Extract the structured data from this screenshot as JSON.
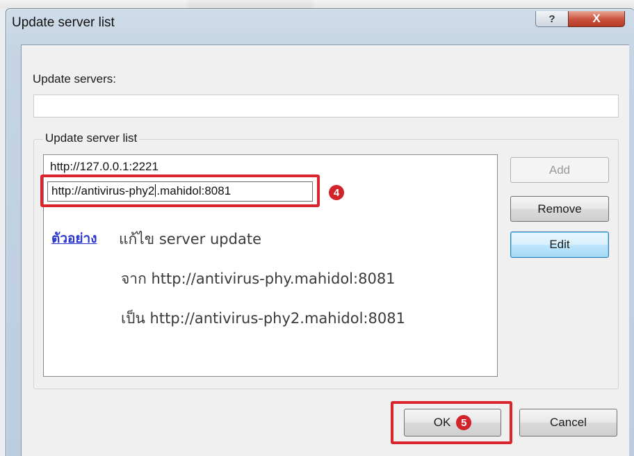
{
  "window": {
    "title": "Update server list",
    "help_glyph": "?",
    "close_glyph": "X"
  },
  "servers": {
    "label": "Update servers:",
    "value": ""
  },
  "server_list": {
    "legend": "Update server list",
    "items": [
      "http://127.0.0.1:2221"
    ],
    "edit_value_before": "http://antivirus-phy2",
    "edit_value_after": ".mahidol:8081"
  },
  "note": {
    "link": "ตัวอย่าง",
    "line1": "แก้ไข server update",
    "line2": "จาก http://antivirus-phy.mahidol:8081",
    "line3": "เป็น http://antivirus-phy2.mahidol:8081"
  },
  "buttons": {
    "add": "Add",
    "remove": "Remove",
    "edit": "Edit",
    "ok": "OK",
    "cancel": "Cancel"
  },
  "markers": {
    "step4": "4",
    "step5": "5"
  },
  "colors": {
    "highlight": "#d9262c",
    "link": "#2a35d0"
  }
}
